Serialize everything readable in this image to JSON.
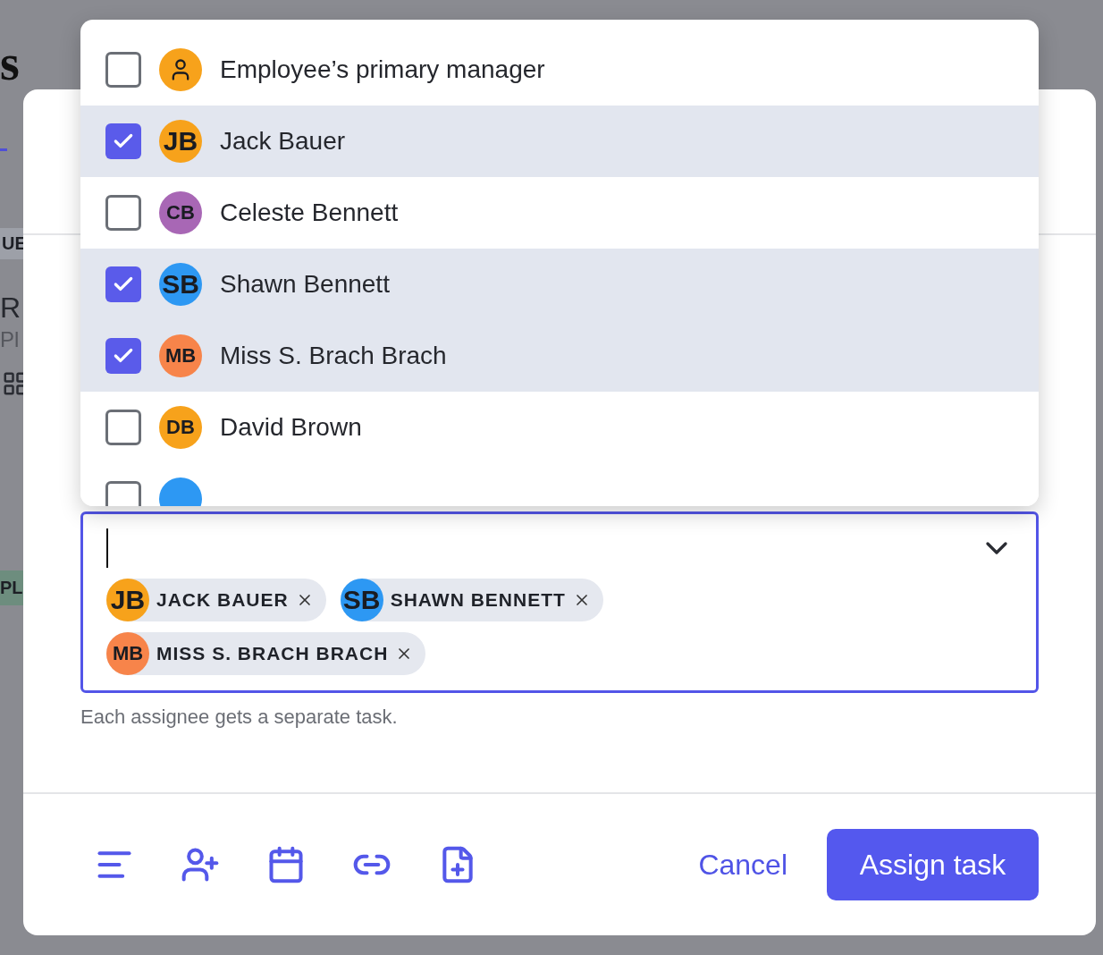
{
  "background": {
    "heading": "s",
    "tag": "UE",
    "title": "R",
    "subtitle": "Pl",
    "status_tag": "PL"
  },
  "dropdown": {
    "items": [
      {
        "kind": "icon",
        "name": "Employee’s primary manager",
        "checked": false,
        "color": "#f7a21b"
      },
      {
        "kind": "initials",
        "initials": "JB",
        "name": "Jack Bauer",
        "checked": true,
        "color": "#f7a21b"
      },
      {
        "kind": "initials",
        "initials": "CB",
        "name": "Celeste Bennett",
        "checked": false,
        "color": "#a867b5"
      },
      {
        "kind": "initials",
        "initials": "SB",
        "name": "Shawn Bennett",
        "checked": true,
        "color": "#2d98f3"
      },
      {
        "kind": "initials",
        "initials": "MB",
        "name": "Miss S. Brach Brach",
        "checked": true,
        "color": "#f7844a"
      },
      {
        "kind": "initials",
        "initials": "DB",
        "name": "David Brown",
        "checked": false,
        "color": "#f7a21b"
      },
      {
        "kind": "partial",
        "checked": false,
        "color": "#2d98f3"
      }
    ]
  },
  "field": {
    "chips": [
      {
        "initials": "JB",
        "label": "JACK BAUER",
        "color": "#f7a21b"
      },
      {
        "initials": "SB",
        "label": "SHAWN BENNETT",
        "color": "#2d98f3"
      },
      {
        "initials": "MB",
        "label": "MISS S. BRACH BRACH",
        "color": "#f7844a"
      }
    ],
    "hint": "Each assignee gets a separate task."
  },
  "footer": {
    "cancel": "Cancel",
    "submit": "Assign task"
  }
}
